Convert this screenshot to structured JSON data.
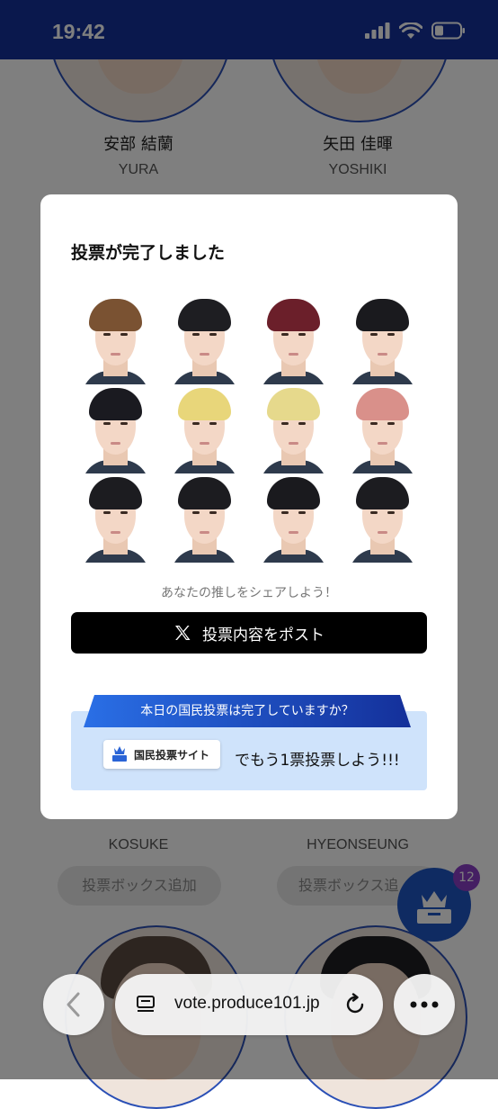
{
  "status_bar": {
    "time": "19:42"
  },
  "background": {
    "top_members": [
      {
        "jp_name": "安部 結蘭",
        "en_name": "YURA"
      },
      {
        "jp_name": "矢田 佳暉",
        "en_name": "YOSHIKI"
      }
    ],
    "bottom_members": [
      {
        "jp_name": "",
        "en_name": "KOSUKE"
      },
      {
        "jp_name": "",
        "en_name": "HYEONSEUNG"
      }
    ],
    "vote_box_label": "投票ボックス追加",
    "vote_box_label_right": "投票ボックス追",
    "fab_badge": "12"
  },
  "modal": {
    "title": "投票が完了しました",
    "portraits": [
      {
        "hair": "#7a5232"
      },
      {
        "hair": "#1e1e22"
      },
      {
        "hair": "#6b1f2a"
      },
      {
        "hair": "#1a1a1e"
      },
      {
        "hair": "#1a1a20"
      },
      {
        "hair": "#e8d67a"
      },
      {
        "hair": "#e6d98c"
      },
      {
        "hair": "#d9908a"
      },
      {
        "hair": "#1c1c20"
      },
      {
        "hair": "#1c1c20"
      },
      {
        "hair": "#1a1a1e"
      },
      {
        "hair": "#1c1c20"
      }
    ],
    "share_hint": "あなたの推しをシェアしよう！",
    "post_button": "投票内容をポスト",
    "banner_heading": "本日の国民投票は完了していますか？",
    "site_badge": "国民投票サイト",
    "banner_text": "でもう1票投票しよう!!!"
  },
  "browser": {
    "url": "vote.produce101.jp"
  },
  "colors": {
    "status_bar": "#14309a",
    "accent": "#1f56c4",
    "post_button": "#000000",
    "banner_bg": "#cfe3fb"
  }
}
